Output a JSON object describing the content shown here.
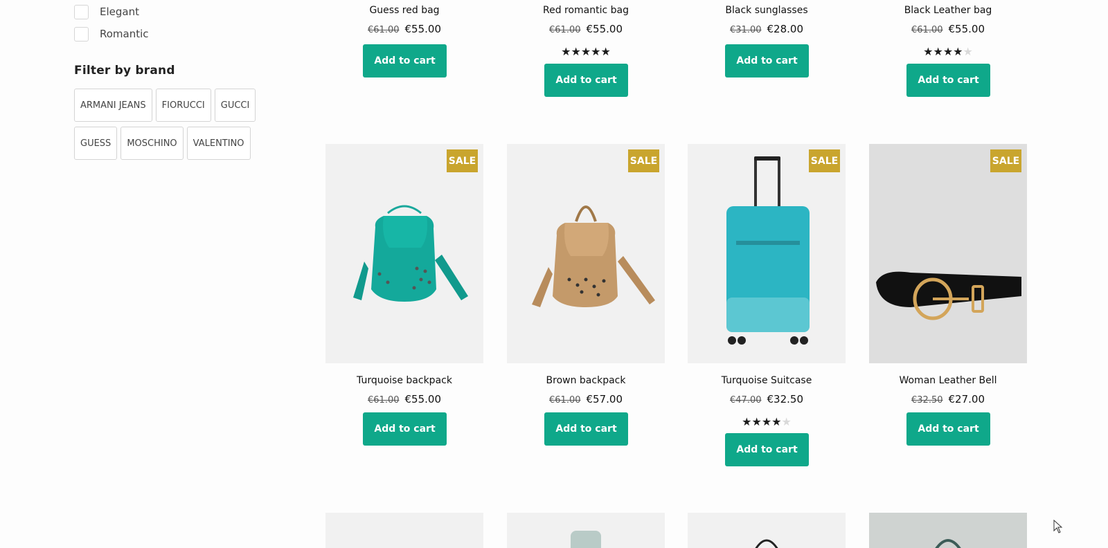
{
  "sidebar": {
    "styles": [
      {
        "label": "Elegant"
      },
      {
        "label": "Romantic"
      }
    ],
    "brand_title": "Filter by brand",
    "brands": [
      "ARMANI JEANS",
      "FIORUCCI",
      "GUCCI",
      "GUESS",
      "MOSCHINO",
      "VALENTINO"
    ]
  },
  "products_top": [
    {
      "name": "Guess red bag",
      "old_price": "€61.00",
      "price": "€55.00",
      "rating": 0,
      "cart_label": "Add to cart"
    },
    {
      "name": "Red romantic bag",
      "old_price": "€61.00",
      "price": "€55.00",
      "rating": 5,
      "cart_label": "Add to cart"
    },
    {
      "name": "Black sunglasses",
      "old_price": "€31.00",
      "price": "€28.00",
      "rating": 0,
      "cart_label": "Add to cart"
    },
    {
      "name": "Black Leather bag",
      "old_price": "€61.00",
      "price": "€55.00",
      "rating": 4,
      "cart_label": "Add to cart"
    }
  ],
  "products_mid": [
    {
      "name": "Turquoise backpack",
      "old_price": "€61.00",
      "price": "€55.00",
      "rating": 0,
      "badge": "SALE",
      "image": "turquoise-backpack",
      "cart_label": "Add to cart"
    },
    {
      "name": "Brown backpack",
      "old_price": "€61.00",
      "price": "€57.00",
      "rating": 0,
      "badge": "SALE",
      "image": "brown-backpack",
      "cart_label": "Add to cart"
    },
    {
      "name": "Turquoise Suitcase",
      "old_price": "€47.00",
      "price": "€32.50",
      "rating": 4,
      "badge": "SALE",
      "image": "turquoise-suitcase",
      "cart_label": "Add to cart"
    },
    {
      "name": "Woman Leather Bell",
      "old_price": "€32.50",
      "price": "€27.00",
      "rating": 0,
      "badge": "SALE",
      "image": "black-belt",
      "cart_label": "Add to cart"
    }
  ],
  "colors": {
    "button": "#0fa88a",
    "sale_badge": "#c9a52e",
    "star": "#1c1c1c"
  }
}
